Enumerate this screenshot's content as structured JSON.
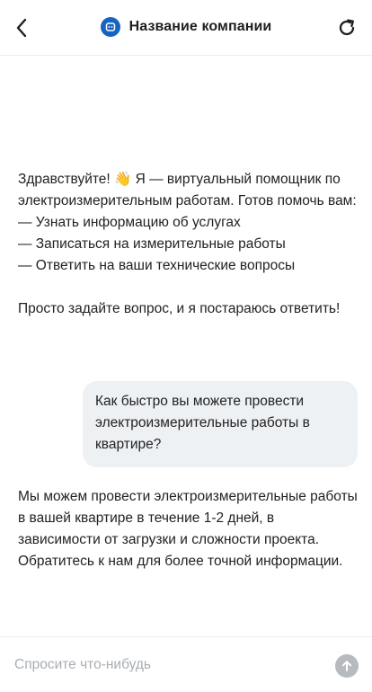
{
  "header": {
    "title": "Название компании",
    "back_icon": "chevron-left-icon",
    "refresh_icon": "refresh-icon",
    "logo_icon": "chat-bot-icon",
    "accent_color": "#1565c0"
  },
  "messages": [
    {
      "role": "bot",
      "text": "Здравствуйте! 👋 Я — виртуальный помощник по электроизмерительным работам. Готов помочь вам:\n— Узнать информацию об услугах\n— Записаться на измерительные работы\n— Ответить на ваши технические вопросы\n\nПросто задайте вопрос, и я постараюсь ответить!"
    },
    {
      "role": "user",
      "text": "Как быстро вы можете провести электроизмерительные работы в квартире?"
    },
    {
      "role": "bot",
      "text": "Мы можем провести электроизмерительные работы в вашей квартире в течение 1-2 дней, в зависимости от загрузки и сложности проекта. Обратитесь к нам для более точной информации."
    }
  ],
  "composer": {
    "placeholder": "Спросите что-нибудь",
    "value": "",
    "send_icon": "arrow-up-icon"
  }
}
